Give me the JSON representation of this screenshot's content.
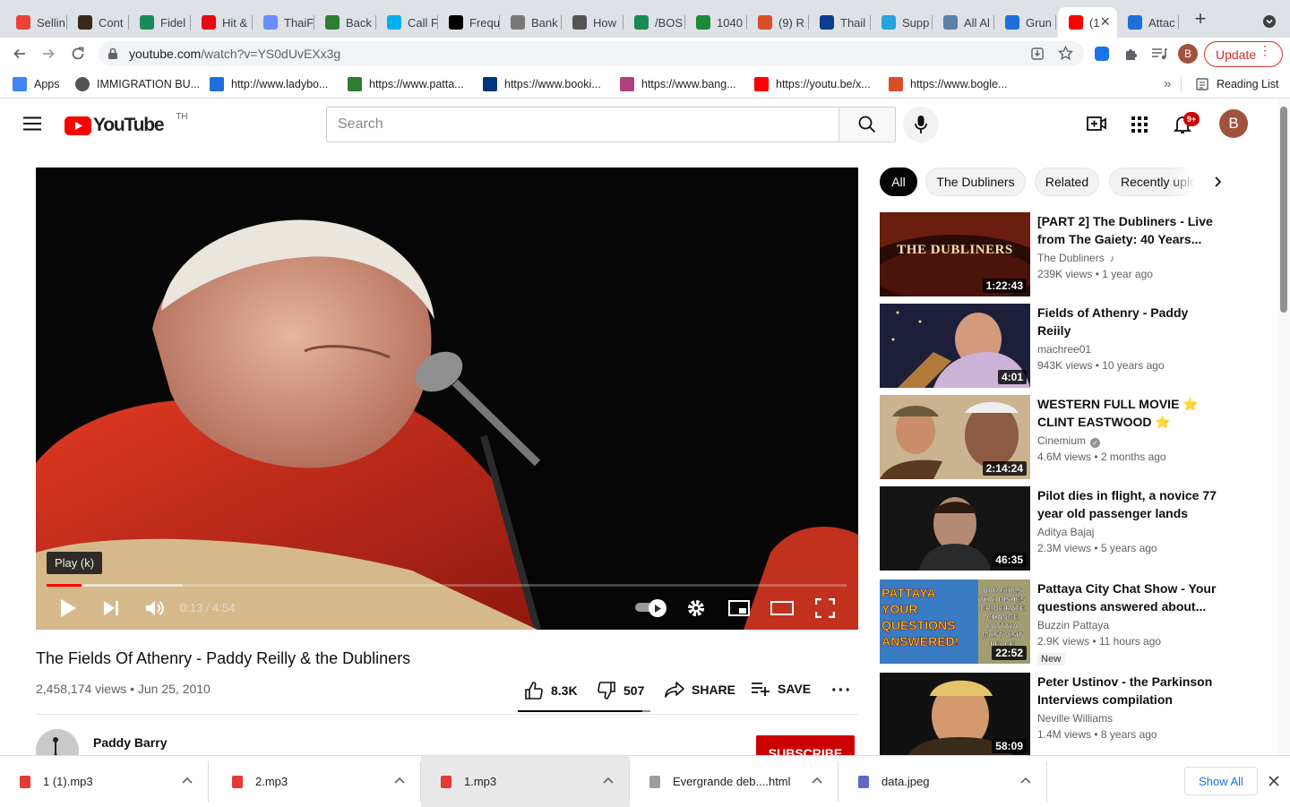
{
  "browser": {
    "tabs": [
      {
        "label": "Sellin",
        "icon": "gmail-icon",
        "color": "#ea4335"
      },
      {
        "label": "Cont",
        "icon": "circle-logo-icon",
        "color": "#3b2a1a"
      },
      {
        "label": "Fidel",
        "icon": "fidelity-icon",
        "color": "#1a8a5a"
      },
      {
        "label": "Hit &",
        "icon": "netflix-icon",
        "color": "#e50914"
      },
      {
        "label": "ThaiF",
        "icon": "thaifood-icon",
        "color": "#6a8cff"
      },
      {
        "label": "Back",
        "icon": "needle-icon",
        "color": "#2e7d32"
      },
      {
        "label": "Call F",
        "icon": "skype-icon",
        "color": "#00aff0"
      },
      {
        "label": "Frequ",
        "icon": "wu-icon",
        "color": "#000000"
      },
      {
        "label": "Bank",
        "icon": "amazon-icon",
        "color": "#777777"
      },
      {
        "label": "How",
        "icon": "search-icon",
        "color": "#555555"
      },
      {
        "label": "/BOS",
        "icon": "fidelity-icon",
        "color": "#1a8a5a"
      },
      {
        "label": "1040",
        "icon": "flag-icon",
        "color": "#1b8a3a"
      },
      {
        "label": "(9) R",
        "icon": "asterisk-icon",
        "color": "#d94f2a"
      },
      {
        "label": "Thail",
        "icon": "edge-icon",
        "color": "#0b3d91"
      },
      {
        "label": "Supp",
        "icon": "support-icon",
        "color": "#29a3d9"
      },
      {
        "label": "All Al",
        "icon": "magnifier-icon",
        "color": "#5b7fa6"
      },
      {
        "label": "Grun",
        "icon": "v-logo-icon",
        "color": "#1e6fd9"
      },
      {
        "label": "(1",
        "icon": "youtube-icon",
        "color": "#ff0000"
      },
      {
        "label": "Attac",
        "icon": "v-logo-icon",
        "color": "#1e6fd9"
      }
    ],
    "url_host": "youtube.com",
    "url_path": "/watch?v=YS0dUvEXx3g",
    "profile_letter": "B",
    "update_label": "Update",
    "bookmarks": [
      {
        "label": "Apps",
        "icon": "apps-grid-icon",
        "color": "#4285f4"
      },
      {
        "label": "IMMIGRATION BU...",
        "icon": "globe-icon",
        "color": "#555555"
      },
      {
        "label": "http://www.ladybo...",
        "icon": "v-logo-icon",
        "color": "#1e6fd9"
      },
      {
        "label": "https://www.patta...",
        "icon": "pattaya-icon",
        "color": "#2e7d32"
      },
      {
        "label": "https://www.booki...",
        "icon": "booking-icon",
        "color": "#003580"
      },
      {
        "label": "https://www.bang...",
        "icon": "bangkok-icon",
        "color": "#b0407a"
      },
      {
        "label": "https://youtu.be/x...",
        "icon": "youtube-icon",
        "color": "#ff0000"
      },
      {
        "label": "https://www.bogle...",
        "icon": "asterisk-icon",
        "color": "#d94f2a"
      }
    ],
    "reading_list": "Reading List"
  },
  "youtube": {
    "logo_text": "YouTube",
    "country": "TH",
    "search_placeholder": "Search",
    "notification_count": "9+",
    "avatar_letter": "B",
    "video": {
      "title": "The Fields Of Athenry - Paddy Reilly & the Dubliners",
      "views": "2,458,174 views",
      "date": "Jun 25, 2010",
      "likes": "8.3K",
      "dislikes": "507",
      "share": "SHARE",
      "save": "SAVE",
      "time": "0:13 / 4:54",
      "tooltip": "Play (k)",
      "progress": 0.044,
      "buffered": 0.17
    },
    "channel": {
      "name": "Paddy Barry",
      "subscribe": "SUBSCRIBE"
    },
    "chips": [
      "All",
      "The Dubliners",
      "Related",
      "Recently uploaded"
    ],
    "recommendations": [
      {
        "title": "[PART 2] The Dubliners - Live from The Gaiety: 40 Years...",
        "channel": "The Dubliners",
        "meta": "239K views • 1 year ago",
        "duration": "1:22:43",
        "thumb_text": "THE DUBLINERS",
        "music": true
      },
      {
        "title": "Fields of Athenry - Paddy Reiily",
        "channel": "machree01",
        "meta": "943K views • 10 years ago",
        "duration": "4:01"
      },
      {
        "title": "WESTERN FULL MOVIE ⭐ CLINT EASTWOOD ⭐",
        "channel": "Cinemium",
        "meta": "4.6M views • 2 months ago",
        "duration": "2:14:24",
        "verified": true
      },
      {
        "title": "Pilot dies in flight, a novice 77 year old passenger lands the...",
        "channel": "Aditya Bajaj",
        "meta": "2.3M views • 5 years ago",
        "duration": "46:35"
      },
      {
        "title": "Pattaya City Chat Show - Your questions answered about...",
        "channel": "Buzzin Pattaya",
        "meta": "2.9K views • 11 hours ago",
        "duration": "22:52",
        "badge": "New",
        "thumb_text": "PATTAYA YOUR QUESTIONS ANSWERED!",
        "thumb_sub": "BAR GIRLS THAI DISHES CRIME RATE CHANGE PATTAYA MUST VISIT PEACE"
      },
      {
        "title": "Peter Ustinov - the Parkinson Interviews compilation",
        "channel": "Neville Williams",
        "meta": "1.4M views • 8 years ago",
        "duration": "58:09"
      }
    ]
  },
  "downloads": {
    "items": [
      "1 (1).mp3",
      "2.mp3",
      "1.mp3",
      "Evergrande deb....html",
      "data.jpeg"
    ],
    "show_all": "Show All"
  }
}
